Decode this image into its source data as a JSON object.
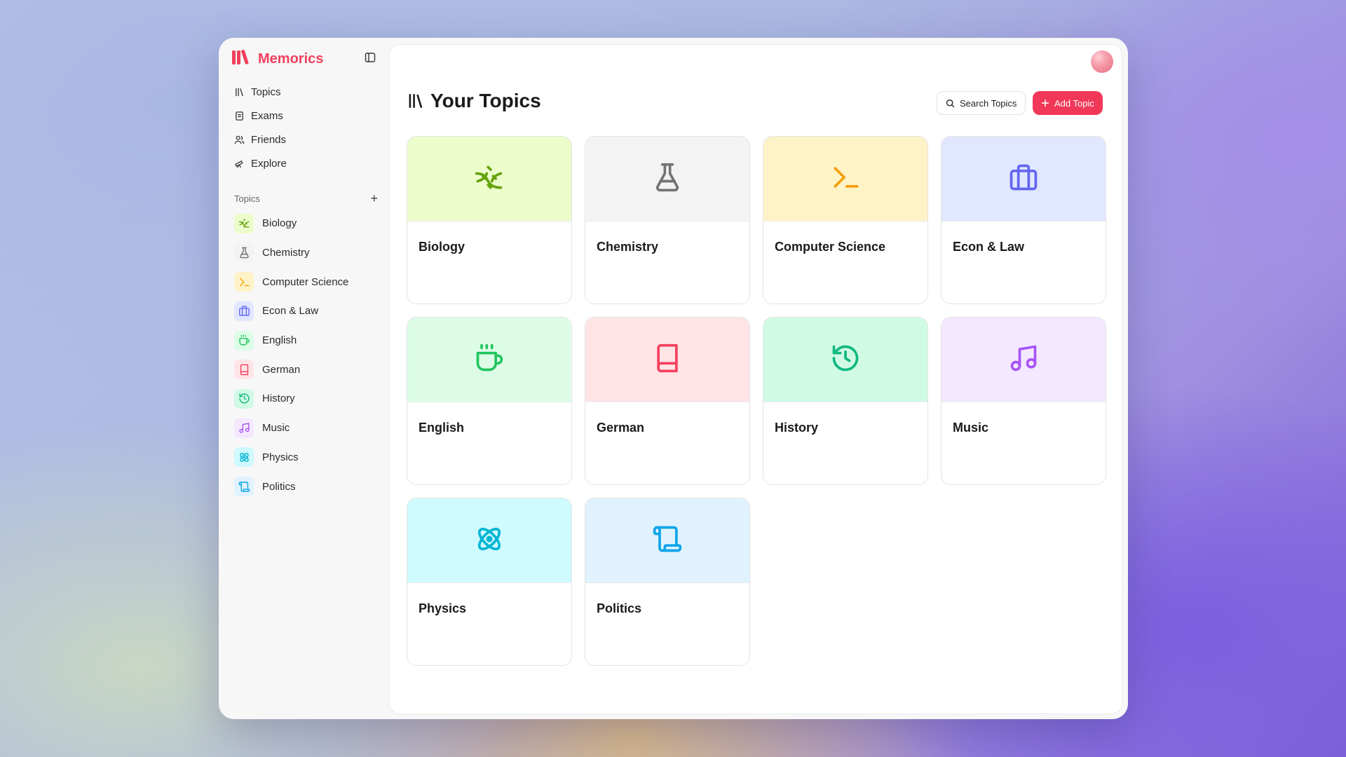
{
  "app": {
    "name": "Memorics",
    "brand_color": "#f0405d"
  },
  "nav": [
    {
      "label": "Topics",
      "icon": "library-icon"
    },
    {
      "label": "Exams",
      "icon": "exam-icon"
    },
    {
      "label": "Friends",
      "icon": "users-icon"
    },
    {
      "label": "Explore",
      "icon": "telescope-icon"
    }
  ],
  "sidebar": {
    "topics_heading": "Topics",
    "add_label": "+"
  },
  "topics": [
    {
      "label": "Biology",
      "icon": "dna-icon",
      "color": "#65a30d",
      "bg": "#ecfccb"
    },
    {
      "label": "Chemistry",
      "icon": "flask-icon",
      "color": "#737373",
      "bg": "#f3f3f3"
    },
    {
      "label": "Computer Science",
      "icon": "terminal-icon",
      "color": "#f59e0b",
      "bg": "#fef3c7"
    },
    {
      "label": "Econ & Law",
      "icon": "briefcase-icon",
      "color": "#6366f1",
      "bg": "#e0e7ff"
    },
    {
      "label": "English",
      "icon": "coffee-icon",
      "color": "#22c55e",
      "bg": "#dcfce7"
    },
    {
      "label": "German",
      "icon": "book-icon",
      "color": "#f43f5e",
      "bg": "#ffe4e6"
    },
    {
      "label": "History",
      "icon": "history-icon",
      "color": "#10b981",
      "bg": "#d1fae5"
    },
    {
      "label": "Music",
      "icon": "music-icon",
      "color": "#a855f7",
      "bg": "#f3e8ff"
    },
    {
      "label": "Physics",
      "icon": "atom-icon",
      "color": "#06b6d4",
      "bg": "#cffafe"
    },
    {
      "label": "Politics",
      "icon": "scroll-icon",
      "color": "#0ea5e9",
      "bg": "#e0f2fe"
    }
  ],
  "main": {
    "title": "Your Topics",
    "search_label": "Search Topics",
    "add_label": "Add Topic",
    "accent": "#f13859"
  }
}
